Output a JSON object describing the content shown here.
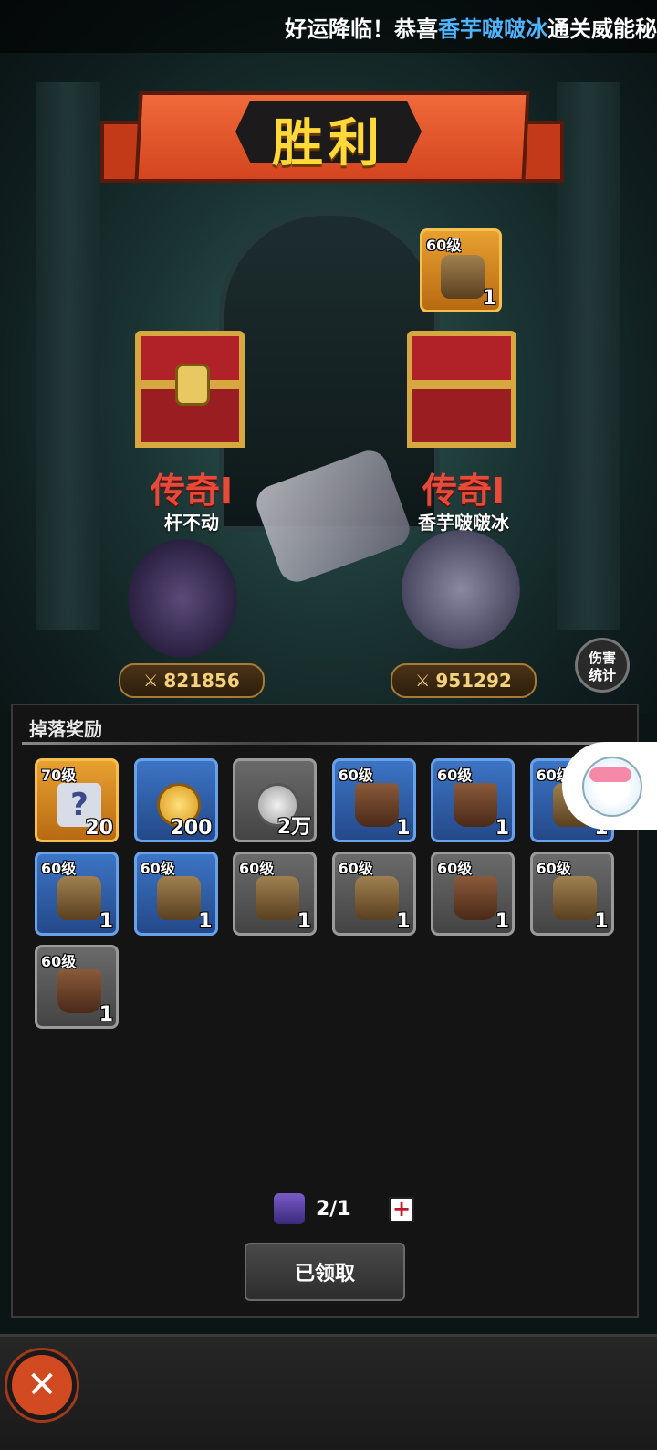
{
  "ticker": {
    "pre": "好运降临！恭喜",
    "highlight": "香芋啵啵冰",
    "post": "通关威能秘"
  },
  "banner": {
    "title": "胜利"
  },
  "bonus_item": {
    "level": "60级",
    "count": "1"
  },
  "players": [
    {
      "rank": "传奇I",
      "name": "杆不动",
      "score": "821856"
    },
    {
      "rank": "传奇I",
      "name": "香芋啵啵冰",
      "score": "951292"
    }
  ],
  "damage_stats": {
    "line1": "伤害",
    "line2": "统计"
  },
  "rewards": {
    "title": "掉落奖励",
    "items": [
      {
        "level": "70级",
        "count": "20",
        "rarity": "orange",
        "icon": "puzzle-icon"
      },
      {
        "level": "",
        "count": "200",
        "rarity": "blue",
        "icon": "gold-coin-icon"
      },
      {
        "level": "",
        "count": "2万",
        "rarity": "gray",
        "icon": "silver-coin-icon"
      },
      {
        "level": "60级",
        "count": "1",
        "rarity": "blue",
        "icon": "boots-icon"
      },
      {
        "level": "60级",
        "count": "1",
        "rarity": "blue",
        "icon": "boots-icon"
      },
      {
        "level": "60级",
        "count": "1",
        "rarity": "blue",
        "icon": "armor-icon"
      },
      {
        "level": "60级",
        "count": "1",
        "rarity": "blue",
        "icon": "belt-icon"
      },
      {
        "level": "60级",
        "count": "1",
        "rarity": "blue",
        "icon": "shoulder-icon"
      },
      {
        "level": "60级",
        "count": "1",
        "rarity": "gray",
        "icon": "spear-icon"
      },
      {
        "level": "60级",
        "count": "1",
        "rarity": "gray",
        "icon": "chest-armor-icon"
      },
      {
        "level": "60级",
        "count": "1",
        "rarity": "gray",
        "icon": "gauntlet-icon"
      },
      {
        "level": "60级",
        "count": "1",
        "rarity": "gray",
        "icon": "bow-icon"
      },
      {
        "level": "60级",
        "count": "1",
        "rarity": "gray",
        "icon": "gauntlet-icon"
      }
    ]
  },
  "ticket": {
    "value": "2/1",
    "plus": "+"
  },
  "claim_button": {
    "label": "已领取"
  },
  "close_button": {
    "label": "✕"
  }
}
